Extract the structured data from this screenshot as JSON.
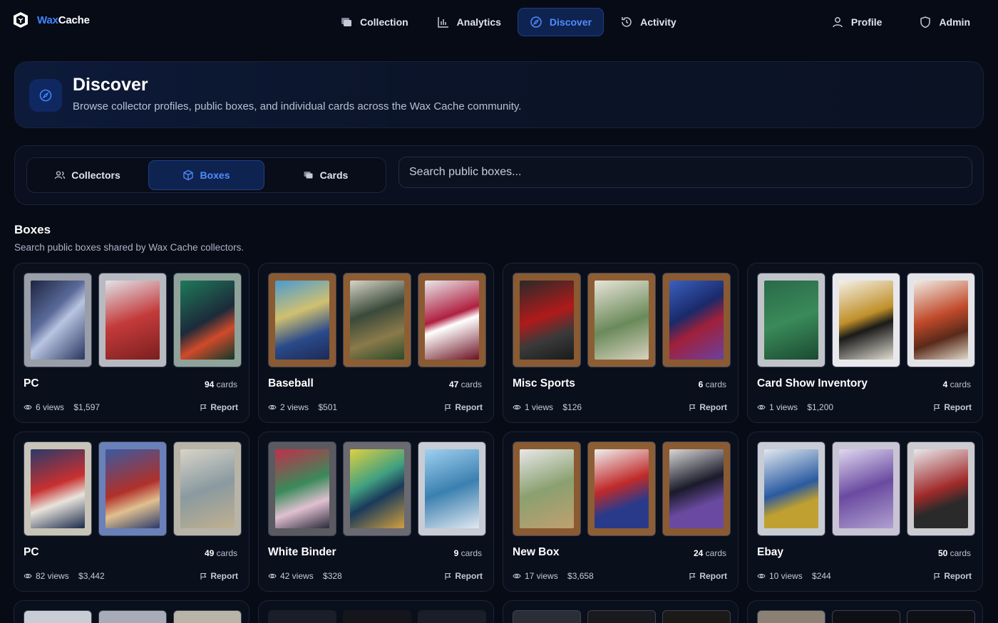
{
  "brand": {
    "wax": "Wax",
    "cache": "Cache"
  },
  "nav": {
    "collection": "Collection",
    "analytics": "Analytics",
    "discover": "Discover",
    "activity": "Activity",
    "profile": "Profile",
    "admin": "Admin"
  },
  "hero": {
    "title": "Discover",
    "subtitle": "Browse collector profiles, public boxes, and individual cards across the Wax Cache community."
  },
  "tabs": {
    "collectors": "Collectors",
    "boxes": "Boxes",
    "cards": "Cards"
  },
  "search": {
    "placeholder": "Search public boxes..."
  },
  "section": {
    "title": "Boxes",
    "subtitle": "Search public boxes shared by Wax Cache collectors."
  },
  "colors": {
    "accent": "#3f86ff",
    "active_bg": "#0f2350"
  },
  "boxes": [
    {
      "name": "PC",
      "count": "94",
      "count_unit": "cards",
      "views": "6 views",
      "value": "$1,597",
      "report": "Report"
    },
    {
      "name": "Baseball",
      "count": "47",
      "count_unit": "cards",
      "views": "2 views",
      "value": "$501",
      "report": "Report"
    },
    {
      "name": "Misc Sports",
      "count": "6",
      "count_unit": "cards",
      "views": "1 views",
      "value": "$126",
      "report": "Report"
    },
    {
      "name": "Card Show Inventory",
      "count": "4",
      "count_unit": "cards",
      "views": "1 views",
      "value": "$1,200",
      "report": "Report"
    },
    {
      "name": "PC",
      "count": "49",
      "count_unit": "cards",
      "views": "82 views",
      "value": "$3,442",
      "report": "Report"
    },
    {
      "name": "White Binder",
      "count": "9",
      "count_unit": "cards",
      "views": "42 views",
      "value": "$328",
      "report": "Report"
    },
    {
      "name": "New Box",
      "count": "24",
      "count_unit": "cards",
      "views": "17 views",
      "value": "$3,658",
      "report": "Report"
    },
    {
      "name": "Ebay",
      "count": "50",
      "count_unit": "cards",
      "views": "10 views",
      "value": "$244",
      "report": "Report"
    }
  ]
}
